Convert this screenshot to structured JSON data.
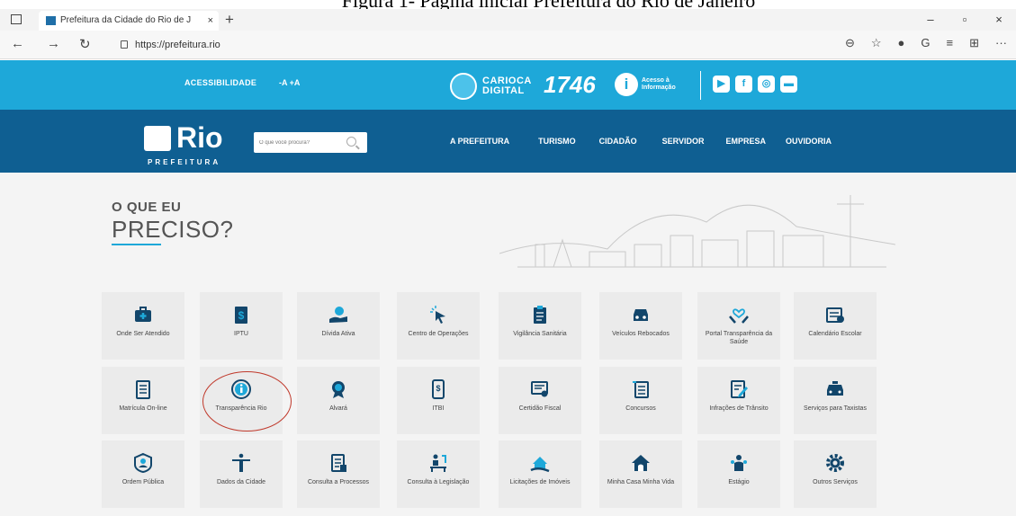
{
  "caption": "Figura 1- Página inicial Prefeitura do Rio de Janeiro",
  "browser": {
    "tab_title": "Prefeitura da Cidade do Rio de J",
    "tab_close": "×",
    "new_tab": "+",
    "url": "https://prefeitura.rio",
    "win_min": "–",
    "win_max": "▫",
    "win_close": "×"
  },
  "topbar": {
    "accessibility": "ACESSIBILIDADE",
    "font_size": "-A  +A",
    "carioca_line1": "CARIOCA",
    "carioca_line2": "DIGITAL",
    "number_1746": "1746",
    "acesso_line1": "Acesso à",
    "acesso_line2": "Informação"
  },
  "header": {
    "logo_text": "Rio",
    "logo_sub": "PREFEITURA",
    "search_placeholder": "O que você procura?",
    "menu": [
      "A PREFEITURA",
      "TURISMO",
      "CIDADÃO",
      "SERVIDOR",
      "EMPRESA",
      "OUVIDORIA"
    ]
  },
  "main": {
    "heading_small": "O QUE EU",
    "heading_big": "PRECISO?",
    "cards": [
      {
        "label": "Onde Ser Atendido",
        "icon": "briefcase-medical-icon"
      },
      {
        "label": "IPTU",
        "icon": "dollar-document-icon"
      },
      {
        "label": "Dívida Ativa",
        "icon": "hand-coin-icon"
      },
      {
        "label": "Centro de Operações",
        "icon": "cursor-click-icon"
      },
      {
        "label": "Vigilância Sanitária",
        "icon": "clipboard-icon"
      },
      {
        "label": "Veículos Rebocados",
        "icon": "car-icon"
      },
      {
        "label": "Portal Transparência da Saúde",
        "icon": "heart-hands-icon"
      },
      {
        "label": "Calendário Escolar",
        "icon": "calendar-icon"
      },
      {
        "label": "Matrícula On-line",
        "icon": "checklist-icon"
      },
      {
        "label": "Transparência Rio",
        "icon": "info-icon"
      },
      {
        "label": "Alvará",
        "icon": "badge-icon"
      },
      {
        "label": "ITBI",
        "icon": "dollar-tablet-icon"
      },
      {
        "label": "Certidão Fiscal",
        "icon": "certificate-icon"
      },
      {
        "label": "Concursos",
        "icon": "document-list-icon"
      },
      {
        "label": "Infrações de Trânsito",
        "icon": "edit-document-icon"
      },
      {
        "label": "Serviços para Taxistas",
        "icon": "taxi-icon"
      },
      {
        "label": "Ordem Pública",
        "icon": "person-badge-icon"
      },
      {
        "label": "Dados da Cidade",
        "icon": "christ-statue-icon"
      },
      {
        "label": "Consulta a Processos",
        "icon": "scroll-icon"
      },
      {
        "label": "Consulta à Legislação",
        "icon": "person-desk-icon"
      },
      {
        "label": "Licitações de Imóveis",
        "icon": "house-hand-icon"
      },
      {
        "label": "Minha Casa Minha Vida",
        "icon": "house-icon"
      },
      {
        "label": "Estágio",
        "icon": "people-icon"
      },
      {
        "label": "Outros Serviços",
        "icon": "gear-icon"
      }
    ]
  }
}
